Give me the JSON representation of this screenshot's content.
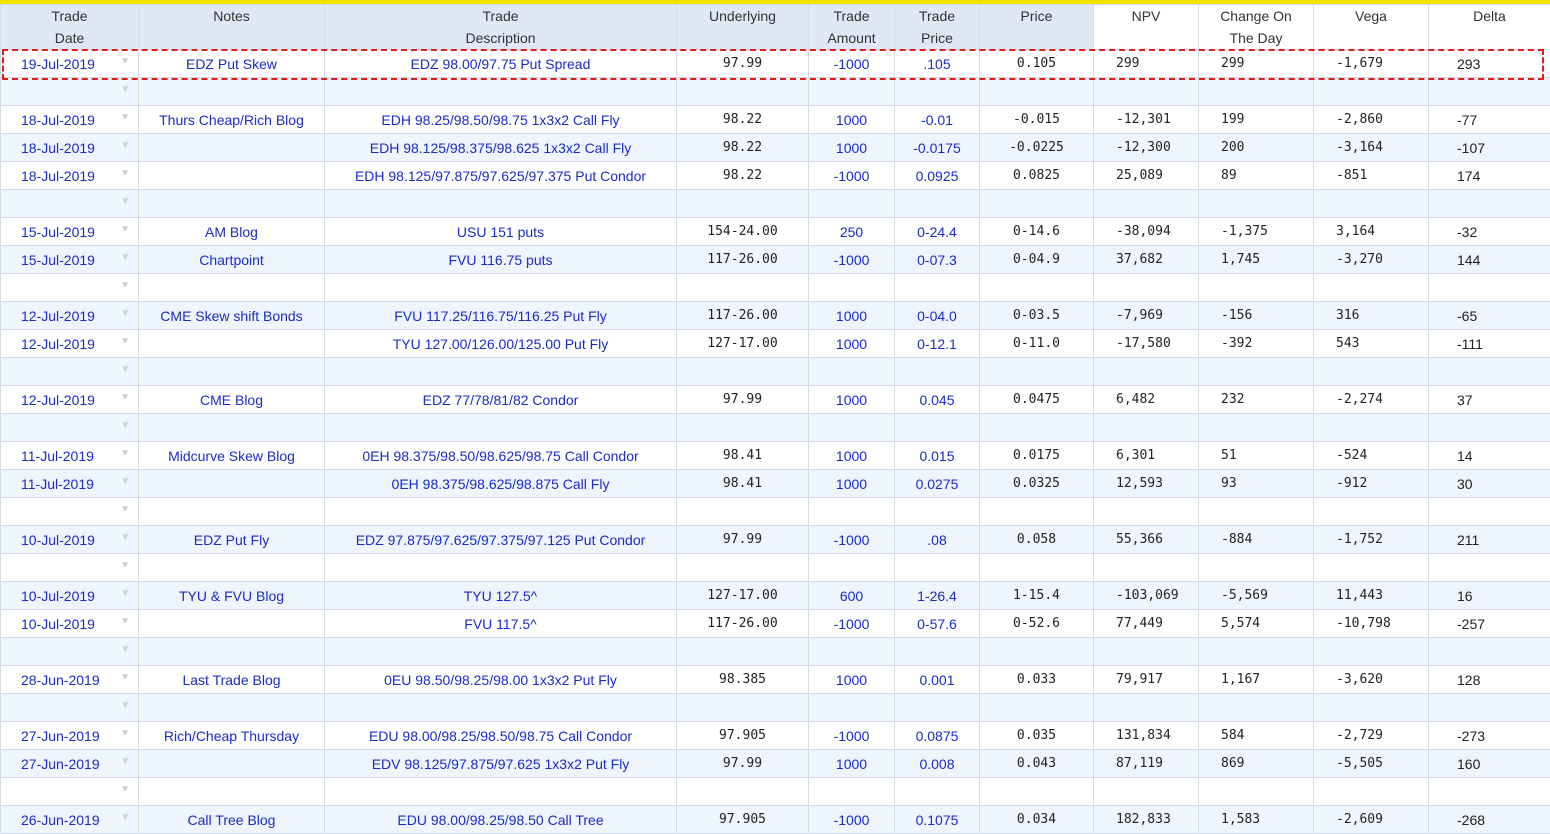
{
  "header": {
    "trade_date": [
      "Trade",
      "Date"
    ],
    "notes": "Notes",
    "trade_description": [
      "Trade",
      "Description"
    ],
    "underlying": "Underlying",
    "trade_amount": [
      "Trade",
      "Amount"
    ],
    "trade_price": [
      "Trade",
      "Price"
    ],
    "price": "Price",
    "npv": "NPV",
    "change_on_the_day": [
      "Change On",
      "The Day"
    ],
    "vega": "Vega",
    "delta": "Delta"
  },
  "rows": [
    {
      "date": "19-Jul-2019",
      "notes": "EDZ Put Skew",
      "desc": "EDZ 98.00/97.75 Put Spread",
      "und": "97.99",
      "amt": "-1000",
      "tp": ".105",
      "price": "0.105",
      "npv": "299",
      "chg": "299",
      "vega": "-1,679",
      "delta": "293"
    },
    {
      "sep": true
    },
    {
      "date": "18-Jul-2019",
      "notes": "Thurs Cheap/Rich Blog",
      "desc": "EDH 98.25/98.50/98.75 1x3x2 Call Fly",
      "und": "98.22",
      "amt": "1000",
      "tp": "-0.01",
      "price": "-0.015",
      "npv": "-12,301",
      "chg": "199",
      "vega": "-2,860",
      "delta": "-77"
    },
    {
      "date": "18-Jul-2019",
      "notes": "",
      "desc": "EDH 98.125/98.375/98.625 1x3x2 Call Fly",
      "und": "98.22",
      "amt": "1000",
      "tp": "-0.0175",
      "price": "-0.0225",
      "npv": "-12,300",
      "chg": "200",
      "vega": "-3,164",
      "delta": "-107"
    },
    {
      "date": "18-Jul-2019",
      "notes": "",
      "desc": "EDH 98.125/97.875/97.625/97.375 Put Condor",
      "und": "98.22",
      "amt": "-1000",
      "tp": "0.0925",
      "price": "0.0825",
      "npv": "25,089",
      "chg": "89",
      "vega": "-851",
      "delta": "174"
    },
    {
      "sep": true
    },
    {
      "date": "15-Jul-2019",
      "notes": "AM Blog",
      "desc": "USU 151 puts",
      "und": "154-24.00",
      "amt": "250",
      "tp": "0-24.4",
      "price": "0-14.6",
      "npv": "-38,094",
      "chg": "-1,375",
      "vega": "3,164",
      "delta": "-32"
    },
    {
      "date": "15-Jul-2019",
      "notes": "Chartpoint",
      "desc": "FVU 116.75 puts",
      "und": "117-26.00",
      "amt": "-1000",
      "tp": "0-07.3",
      "price": "0-04.9",
      "npv": "37,682",
      "chg": "1,745",
      "vega": "-3,270",
      "delta": "144"
    },
    {
      "sep": true
    },
    {
      "date": "12-Jul-2019",
      "notes": "CME Skew shift Bonds",
      "desc": "FVU 117.25/116.75/116.25 Put Fly",
      "und": "117-26.00",
      "amt": "1000",
      "tp": "0-04.0",
      "price": "0-03.5",
      "npv": "-7,969",
      "chg": "-156",
      "vega": "316",
      "delta": "-65"
    },
    {
      "date": "12-Jul-2019",
      "notes": "",
      "desc": "TYU 127.00/126.00/125.00 Put Fly",
      "und": "127-17.00",
      "amt": "1000",
      "tp": "0-12.1",
      "price": "0-11.0",
      "npv": "-17,580",
      "chg": "-392",
      "vega": "543",
      "delta": "-111"
    },
    {
      "sep": true
    },
    {
      "date": "12-Jul-2019",
      "notes": "CME Blog",
      "desc": "EDZ 77/78/81/82 Condor",
      "und": "97.99",
      "amt": "1000",
      "tp": "0.045",
      "price": "0.0475",
      "npv": "6,482",
      "chg": "232",
      "vega": "-2,274",
      "delta": "37"
    },
    {
      "sep": true
    },
    {
      "date": "11-Jul-2019",
      "notes": "Midcurve Skew Blog",
      "desc": "0EH 98.375/98.50/98.625/98.75 Call Condor",
      "und": "98.41",
      "amt": "1000",
      "tp": "0.015",
      "price": "0.0175",
      "npv": "6,301",
      "chg": "51",
      "vega": "-524",
      "delta": "14"
    },
    {
      "date": "11-Jul-2019",
      "notes": "",
      "desc": "0EH 98.375/98.625/98.875 Call Fly",
      "und": "98.41",
      "amt": "1000",
      "tp": "0.0275",
      "price": "0.0325",
      "npv": "12,593",
      "chg": "93",
      "vega": "-912",
      "delta": "30"
    },
    {
      "sep": true
    },
    {
      "date": "10-Jul-2019",
      "notes": "EDZ Put Fly",
      "desc": "EDZ 97.875/97.625/97.375/97.125 Put Condor",
      "und": "97.99",
      "amt": "-1000",
      "tp": ".08",
      "price": "0.058",
      "npv": "55,366",
      "chg": "-884",
      "vega": "-1,752",
      "delta": "211"
    },
    {
      "sep": true
    },
    {
      "date": "10-Jul-2019",
      "notes": "TYU & FVU Blog",
      "desc": "TYU 127.5^",
      "und": "127-17.00",
      "amt": "600",
      "tp": "1-26.4",
      "price": "1-15.4",
      "npv": "-103,069",
      "chg": "-5,569",
      "vega": "11,443",
      "delta": "16"
    },
    {
      "date": "10-Jul-2019",
      "notes": "",
      "desc": "FVU 117.5^",
      "und": "117-26.00",
      "amt": "-1000",
      "tp": "0-57.6",
      "price": "0-52.6",
      "npv": "77,449",
      "chg": "5,574",
      "vega": "-10,798",
      "delta": "-257"
    },
    {
      "sep": true
    },
    {
      "date": "28-Jun-2019",
      "notes": "Last Trade Blog",
      "desc": "0EU 98.50/98.25/98.00 1x3x2 Put Fly",
      "und": "98.385",
      "amt": "1000",
      "tp": "0.001",
      "price": "0.033",
      "npv": "79,917",
      "chg": "1,167",
      "vega": "-3,620",
      "delta": "128"
    },
    {
      "sep": true
    },
    {
      "date": "27-Jun-2019",
      "notes": "Rich/Cheap Thursday",
      "desc": "EDU 98.00/98.25/98.50/98.75 Call Condor",
      "und": "97.905",
      "amt": "-1000",
      "tp": "0.0875",
      "price": "0.035",
      "npv": "131,834",
      "chg": "584",
      "vega": "-2,729",
      "delta": "-273"
    },
    {
      "date": "27-Jun-2019",
      "notes": "",
      "desc": "EDV 98.125/97.875/97.625 1x3x2 Put Fly",
      "und": "97.99",
      "amt": "1000",
      "tp": "0.008",
      "price": "0.043",
      "npv": "87,119",
      "chg": "869",
      "vega": "-5,505",
      "delta": "160"
    },
    {
      "sep": true
    },
    {
      "date": "26-Jun-2019",
      "notes": "Call Tree Blog",
      "desc": "EDU 98.00/98.25/98.50 Call Tree",
      "und": "97.905",
      "amt": "-1000",
      "tp": "0.1075",
      "price": "0.034",
      "npv": "182,833",
      "chg": "1,583",
      "vega": "-2,609",
      "delta": "-268"
    }
  ],
  "icons": {
    "row_dropdown": "chevron-down-icon"
  },
  "colors": {
    "top_bar": "#f4e300",
    "link_text": "#1b2bc4",
    "header_bg": "#dfe8f5",
    "alt_row_bg": "#eef5fd",
    "highlight_border": "#e21b1b"
  }
}
